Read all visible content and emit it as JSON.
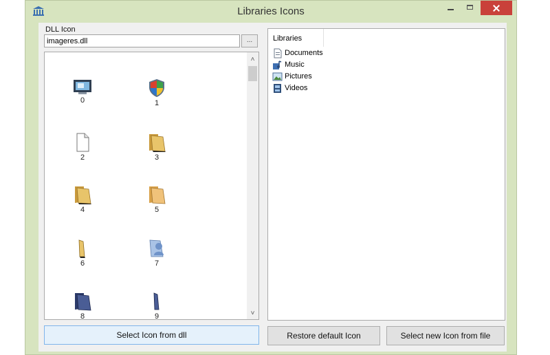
{
  "window": {
    "title": "Libraries Icons"
  },
  "dll": {
    "group_label": "DLL Icon",
    "value": "imageres.dll",
    "browse_label": "..."
  },
  "icons": [
    {
      "index": "0",
      "icon": "computer-monitor-icon"
    },
    {
      "index": "1",
      "icon": "uac-shield-icon"
    },
    {
      "index": "2",
      "icon": "blank-document-icon"
    },
    {
      "index": "3",
      "icon": "folder-icon"
    },
    {
      "index": "4",
      "icon": "folder-icon"
    },
    {
      "index": "5",
      "icon": "folder-icon"
    },
    {
      "index": "6",
      "icon": "folder-narrow-icon"
    },
    {
      "index": "7",
      "icon": "network-folder-icon"
    },
    {
      "index": "8",
      "icon": "dark-folder-icon"
    },
    {
      "index": "9",
      "icon": "dark-folder-narrow-icon"
    }
  ],
  "libraries": {
    "header": "Libraries",
    "items": [
      {
        "label": "Documents",
        "icon": "documents-library-icon"
      },
      {
        "label": "Music",
        "icon": "music-library-icon"
      },
      {
        "label": "Pictures",
        "icon": "pictures-library-icon"
      },
      {
        "label": "Videos",
        "icon": "videos-library-icon"
      }
    ]
  },
  "buttons": {
    "select_from_dll": "Select Icon from dll",
    "restore_default": "Restore default Icon",
    "select_from_file": "Select new Icon from file"
  },
  "colors": {
    "window_frame": "#d7e4bf",
    "close_button": "#c9413a",
    "folder": "#e8c46a",
    "selected_button": "#e5f1fb"
  }
}
